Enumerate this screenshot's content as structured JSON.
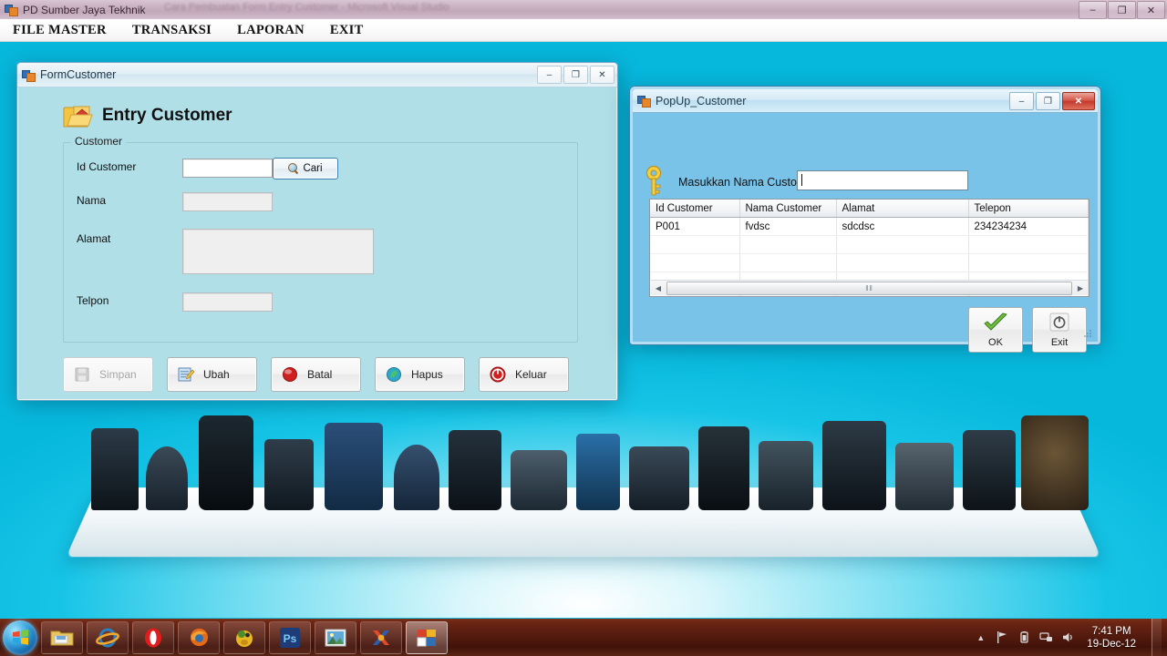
{
  "main_window": {
    "title": "PD Sumber Jaya Tekhnik",
    "ghost_title": "Cara Pembuatan Form Entry Customer - Microsoft Visual Studio",
    "icon": "app-icon",
    "buttons": {
      "minimize": "–",
      "restore": "❐",
      "close": "✕"
    },
    "menu": [
      {
        "label": "FILE MASTER"
      },
      {
        "label": "TRANSAKSI"
      },
      {
        "label": "LAPORAN"
      },
      {
        "label": "EXIT"
      }
    ]
  },
  "form_customer": {
    "title": "FormCustomer",
    "buttons": {
      "minimize": "–",
      "restore": "❐",
      "close": "✕"
    },
    "heading": "Entry Customer",
    "heading_icon": "folder-open-icon",
    "group_title": "Customer",
    "fields": [
      {
        "label": "Id Customer",
        "value": "",
        "state": "enabled"
      },
      {
        "label": "Nama",
        "value": "",
        "state": "disabled"
      },
      {
        "label": "Alamat",
        "value": "",
        "state": "disabled"
      },
      {
        "label": "Telpon",
        "value": "",
        "state": "disabled"
      }
    ],
    "search_button": {
      "label": "Cari",
      "icon": "magnifier-icon"
    },
    "actions": [
      {
        "label": "Simpan",
        "icon": "save-icon",
        "state": "disabled"
      },
      {
        "label": "Ubah",
        "icon": "edit-icon",
        "state": "enabled"
      },
      {
        "label": "Batal",
        "icon": "cancel-icon",
        "state": "enabled"
      },
      {
        "label": "Hapus",
        "icon": "delete-icon",
        "state": "enabled"
      },
      {
        "label": "Keluar",
        "icon": "power-icon",
        "state": "enabled"
      }
    ]
  },
  "popup_customer": {
    "title": "PopUp_Customer",
    "buttons": {
      "minimize": "–",
      "restore": "❐",
      "close": "✕"
    },
    "search_icon": "key-icon",
    "search_label": "Masukkan Nama Customer",
    "search_value": "",
    "search_placeholder": "",
    "grid": {
      "columns": [
        "Id Customer",
        "Nama Customer",
        "Alamat",
        "Telepon"
      ],
      "rows": [
        [
          "P001",
          "fvdsc",
          "sdcdsc",
          "234234234"
        ]
      ],
      "empty_rows": 4,
      "scrollbar": {
        "left_arrow": "◀",
        "right_arrow": "▶",
        "grip": "‖‖"
      }
    },
    "ok_button": {
      "label": "OK",
      "icon": "check-icon"
    },
    "exit_button": {
      "label": "Exit",
      "icon": "power-icon"
    }
  },
  "taskbar": {
    "start": "start-orb",
    "items": [
      {
        "name": "windows-explorer",
        "icon": "folder-icon",
        "active": false
      },
      {
        "name": "internet-explorer",
        "icon": "ie-icon",
        "active": false
      },
      {
        "name": "opera",
        "icon": "opera-icon",
        "active": false
      },
      {
        "name": "firefox",
        "icon": "firefox-icon",
        "active": false
      },
      {
        "name": "media-player",
        "icon": "character-icon",
        "active": false
      },
      {
        "name": "photoshop",
        "icon": "ps-icon",
        "label": "Ps",
        "active": false
      },
      {
        "name": "photo-viewer",
        "icon": "picture-icon",
        "active": false
      },
      {
        "name": "xampp",
        "icon": "xampp-icon",
        "active": false
      },
      {
        "name": "visual-studio",
        "icon": "vs-icon",
        "active": true
      }
    ],
    "tray": {
      "show_hidden": "▲",
      "icons": [
        "network-flag-icon",
        "battery-icon",
        "network-icon",
        "volume-icon"
      ],
      "time": "7:41 PM",
      "date": "19-Dec-12"
    }
  }
}
